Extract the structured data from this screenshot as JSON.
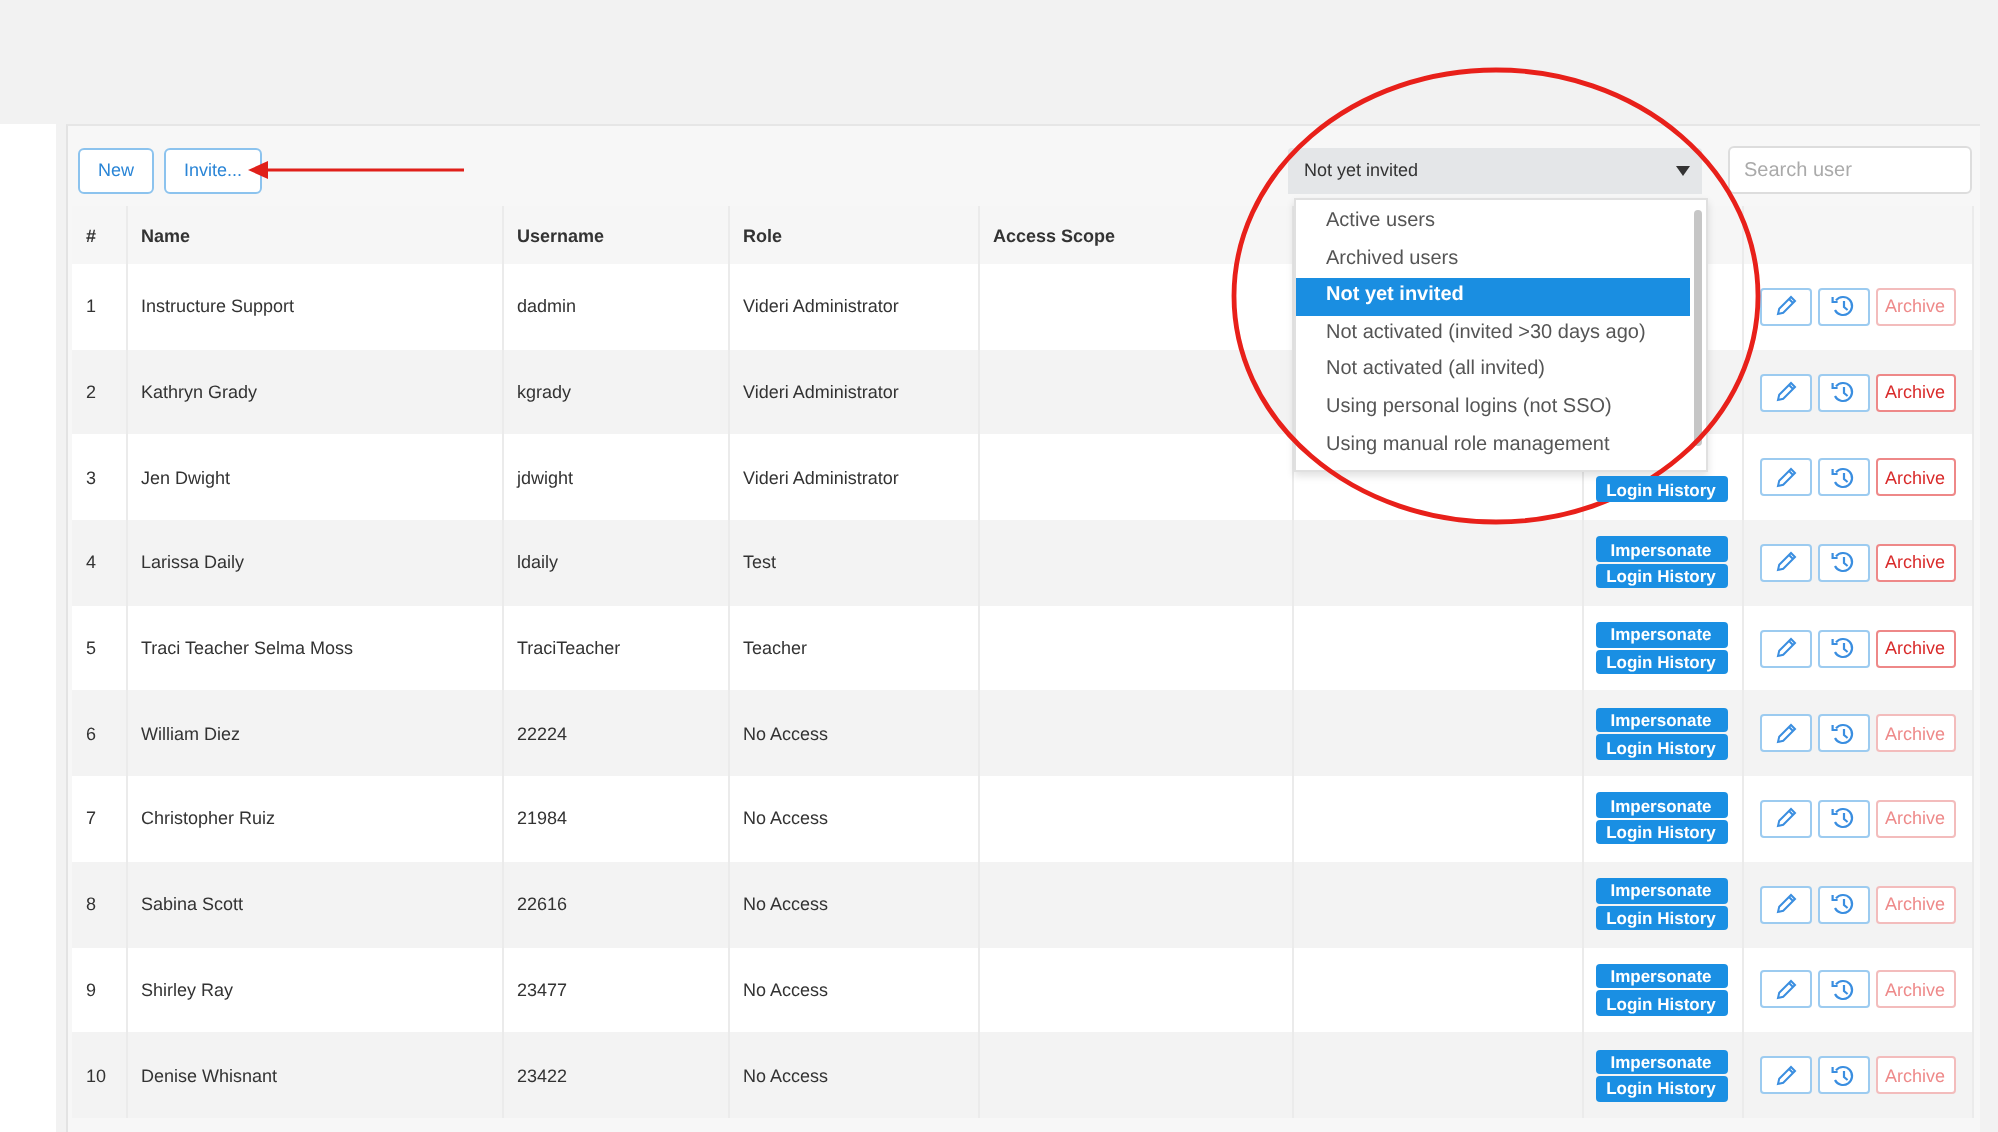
{
  "toolbar": {
    "buttons": [
      "New",
      "Invite..."
    ]
  },
  "filter": {
    "value": "Not yet invited",
    "expanded": true,
    "options": [
      {
        "label": "Active users",
        "selected": false
      },
      {
        "label": "Archived users",
        "selected": false
      },
      {
        "label": "Not yet invited",
        "selected": true
      },
      {
        "label": "Not activated (invited >30 days ago)",
        "selected": false
      },
      {
        "label": "Not activated (all invited)",
        "selected": false
      },
      {
        "label": "Using personal logins (not SSO)",
        "selected": false
      },
      {
        "label": "Using manual role management",
        "selected": false
      }
    ]
  },
  "search": {
    "placeholder": "Search user"
  },
  "table": {
    "columns": [
      "#",
      "Name",
      "Username",
      "Role",
      "Access Scope"
    ],
    "rows": [
      {
        "number": "1",
        "name": "Instructure Support",
        "username": "dadmin",
        "role": "Videri Administrator",
        "buttons": [],
        "archive": {
          "label": "Archive",
          "disabled": true
        }
      },
      {
        "number": "2",
        "name": "Kathryn Grady",
        "username": "kgrady",
        "role": "Videri Administrator",
        "buttons": [],
        "archive": {
          "label": "Archive",
          "disabled": false
        }
      },
      {
        "number": "3",
        "name": "Jen Dwight",
        "username": "jdwight",
        "role": "Videri Administrator",
        "buttons": [
          "Login History"
        ],
        "archive": {
          "label": "Archive",
          "disabled": false
        }
      },
      {
        "number": "4",
        "name": "Larissa Daily",
        "username": "ldaily",
        "role": "Test",
        "buttons": [
          "Impersonate",
          "Login History"
        ],
        "archive": {
          "label": "Archive",
          "disabled": false
        }
      },
      {
        "number": "5",
        "name": "Traci Teacher Selma Moss",
        "username": "TraciTeacher",
        "role": "Teacher",
        "buttons": [
          "Impersonate",
          "Login History"
        ],
        "archive": {
          "label": "Archive",
          "disabled": false
        }
      },
      {
        "number": "6",
        "name": "William Diez",
        "username": "22224",
        "role": "No Access",
        "buttons": [
          "Impersonate",
          "Login History"
        ],
        "archive": {
          "label": "Archive",
          "disabled": true
        }
      },
      {
        "number": "7",
        "name": "Christopher Ruiz",
        "username": "21984",
        "role": "No Access",
        "buttons": [
          "Impersonate",
          "Login History"
        ],
        "archive": {
          "label": "Archive",
          "disabled": true
        }
      },
      {
        "number": "8",
        "name": "Sabina Scott",
        "username": "22616",
        "role": "No Access",
        "buttons": [
          "Impersonate",
          "Login History"
        ],
        "archive": {
          "label": "Archive",
          "disabled": true
        }
      },
      {
        "number": "9",
        "name": "Shirley Ray",
        "username": "23477",
        "role": "No Access",
        "buttons": [
          "Impersonate",
          "Login History"
        ],
        "archive": {
          "label": "Archive",
          "disabled": true
        }
      },
      {
        "number": "10",
        "name": "Denise Whisnant",
        "username": "23422",
        "role": "No Access",
        "buttons": [
          "Impersonate",
          "Login History"
        ],
        "archive": {
          "label": "Archive",
          "disabled": true
        }
      }
    ]
  }
}
